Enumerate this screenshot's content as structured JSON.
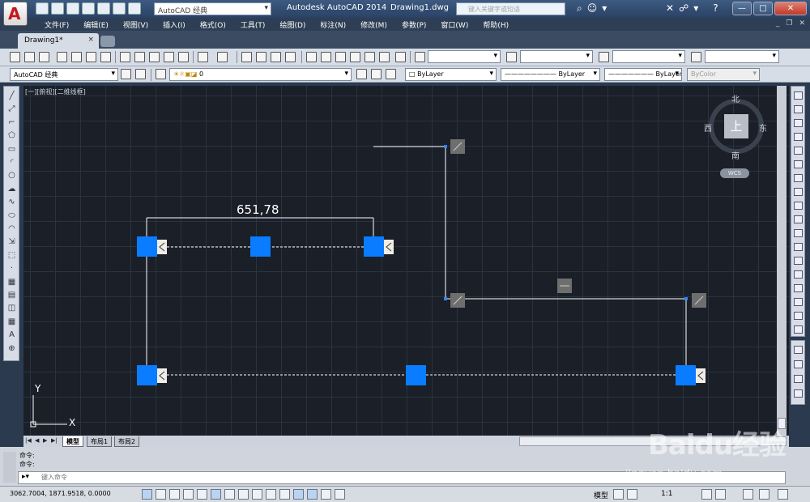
{
  "titlebar": {
    "workspace": "AutoCAD 经典",
    "app_title": "Autodesk AutoCAD 2014",
    "doc_title": "Drawing1.dwg",
    "search_placeholder": "键入关键字或短语"
  },
  "menubar": {
    "items": [
      "文件(F)",
      "编辑(E)",
      "视图(V)",
      "插入(I)",
      "格式(O)",
      "工具(T)",
      "绘图(D)",
      "标注(N)",
      "修改(M)",
      "参数(P)",
      "窗口(W)",
      "帮助(H)"
    ]
  },
  "tabs": {
    "doc_tab": "Drawing1*",
    "close": "×"
  },
  "toolbar2": {
    "workspace": "AutoCAD 经典",
    "layer": "0",
    "color": "ByLayer",
    "linetype": "ByLayer",
    "lineweight": "ByLayer",
    "plotstyle": "ByColor"
  },
  "viewport": {
    "label": "[一][俯视][二维线框]",
    "dimension_text": "651,78",
    "viewcube": {
      "top": "上",
      "north": "北",
      "south": "南",
      "east": "东",
      "west": "西"
    },
    "wcs": "WCS",
    "ucs_x": "X",
    "ucs_y": "Y"
  },
  "layouts": {
    "tabs": [
      "模型",
      "布局1",
      "布局2"
    ],
    "active": "模型"
  },
  "command": {
    "history": [
      "命令:",
      "命令:"
    ],
    "placeholder": "键入命令"
  },
  "statusbar": {
    "coords": "3062.7004, 1871.9518, 0.0000",
    "model": "模型",
    "scale": "1:1"
  },
  "watermark": {
    "brand": "Baidu经验",
    "url": "jingyan.baidu.com"
  },
  "colors": {
    "grip": "#0a7cff",
    "canvas": "#1a1f28",
    "grid": "#2a3340"
  }
}
